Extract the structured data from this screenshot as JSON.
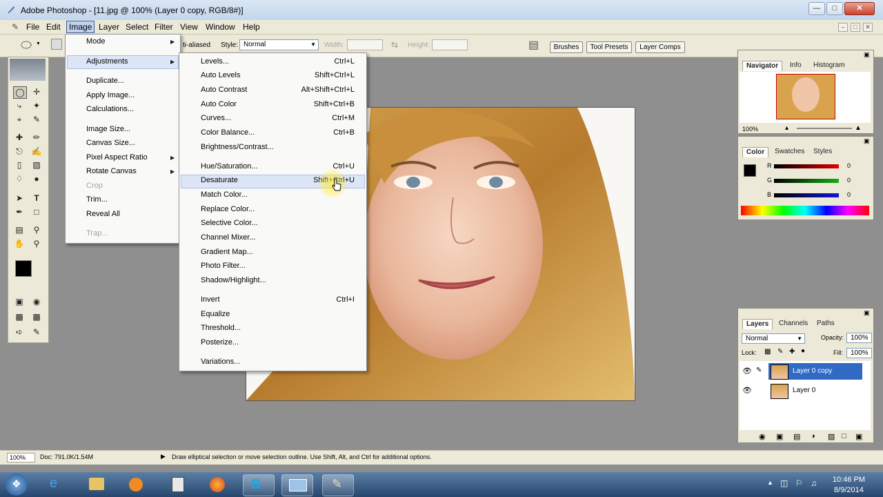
{
  "window": {
    "title": "Adobe Photoshop - [11.jpg @ 100% (Layer 0 copy, RGB/8#)]",
    "btn_min": "—",
    "btn_max": "□",
    "btn_close": "✕"
  },
  "menubar": {
    "items": [
      "File",
      "Edit",
      "Image",
      "Layer",
      "Select",
      "Filter",
      "View",
      "Window",
      "Help"
    ],
    "active": "Image",
    "doc_controls": [
      "–",
      "□",
      "✕"
    ]
  },
  "options": {
    "antialias_label": "ti-aliased",
    "style_label": "Style:",
    "style_value": "Normal",
    "width_label": "Width:",
    "height_label": "Height:",
    "well_tabs": [
      "Brushes",
      "Tool Presets",
      "Layer Comps"
    ]
  },
  "image_menu": {
    "items": [
      {
        "label": "Mode",
        "submenu": true
      },
      {
        "label": "Adjustments",
        "submenu": true,
        "highlighted": true
      },
      {
        "label": "Duplicate..."
      },
      {
        "label": "Apply Image..."
      },
      {
        "label": "Calculations..."
      },
      {
        "label": "Image Size..."
      },
      {
        "label": "Canvas Size..."
      },
      {
        "label": "Pixel Aspect Ratio",
        "submenu": true
      },
      {
        "label": "Rotate Canvas",
        "submenu": true
      },
      {
        "label": "Crop",
        "disabled": true
      },
      {
        "label": "Trim..."
      },
      {
        "label": "Reveal All"
      },
      {
        "label": "Trap...",
        "disabled": true
      }
    ]
  },
  "adjustments_menu": {
    "items": [
      {
        "label": "Levels...",
        "shortcut": "Ctrl+L"
      },
      {
        "label": "Auto Levels",
        "shortcut": "Shift+Ctrl+L"
      },
      {
        "label": "Auto Contrast",
        "shortcut": "Alt+Shift+Ctrl+L"
      },
      {
        "label": "Auto Color",
        "shortcut": "Shift+Ctrl+B"
      },
      {
        "label": "Curves...",
        "shortcut": "Ctrl+M"
      },
      {
        "label": "Color Balance...",
        "shortcut": "Ctrl+B"
      },
      {
        "label": "Brightness/Contrast...",
        "shortcut": ""
      },
      {
        "label": "Hue/Saturation...",
        "shortcut": "Ctrl+U"
      },
      {
        "label": "Desaturate",
        "shortcut": "Shift+Ctrl+U",
        "hovered": true
      },
      {
        "label": "Match Color...",
        "shortcut": ""
      },
      {
        "label": "Replace Color...",
        "shortcut": ""
      },
      {
        "label": "Selective Color...",
        "shortcut": ""
      },
      {
        "label": "Channel Mixer...",
        "shortcut": ""
      },
      {
        "label": "Gradient Map...",
        "shortcut": ""
      },
      {
        "label": "Photo Filter...",
        "shortcut": ""
      },
      {
        "label": "Shadow/Highlight...",
        "shortcut": ""
      },
      {
        "label": "Invert",
        "shortcut": "Ctrl+I"
      },
      {
        "label": "Equalize",
        "shortcut": ""
      },
      {
        "label": "Threshold...",
        "shortcut": ""
      },
      {
        "label": "Posterize...",
        "shortcut": ""
      },
      {
        "label": "Variations...",
        "shortcut": ""
      }
    ]
  },
  "navigator": {
    "tabs": [
      "Navigator",
      "Info",
      "Histogram"
    ],
    "zoom": "100%"
  },
  "color_panel": {
    "tabs": [
      "Color",
      "Swatches",
      "Styles"
    ],
    "channels": [
      {
        "label": "R",
        "value": "0",
        "color": "#cc1111"
      },
      {
        "label": "G",
        "value": "0",
        "color": "#11aa11"
      },
      {
        "label": "B",
        "value": "0",
        "color": "#1111cc"
      }
    ]
  },
  "layers_panel": {
    "tabs": [
      "Layers",
      "Channels",
      "Paths"
    ],
    "blend_mode": "Normal",
    "opacity_label": "Opacity:",
    "opacity": "100%",
    "lock_label": "Lock:",
    "fill_label": "Fill:",
    "fill": "100%",
    "layers": [
      {
        "name": "Layer 0 copy",
        "selected": true
      },
      {
        "name": "Layer 0",
        "selected": false
      }
    ]
  },
  "statusbar": {
    "zoom": "100%",
    "doc": "Doc: 791.0K/1.54M",
    "hint": "Draw elliptical selection or move selection outline.  Use Shift, Alt, and Ctrl for additional options."
  },
  "taskbar": {
    "time": "10:46 PM",
    "date": "8/9/2014"
  },
  "colors": {
    "accent": "#316ac5",
    "menu_bg": "#ece9d8",
    "workspace": "#8f8f8f"
  }
}
